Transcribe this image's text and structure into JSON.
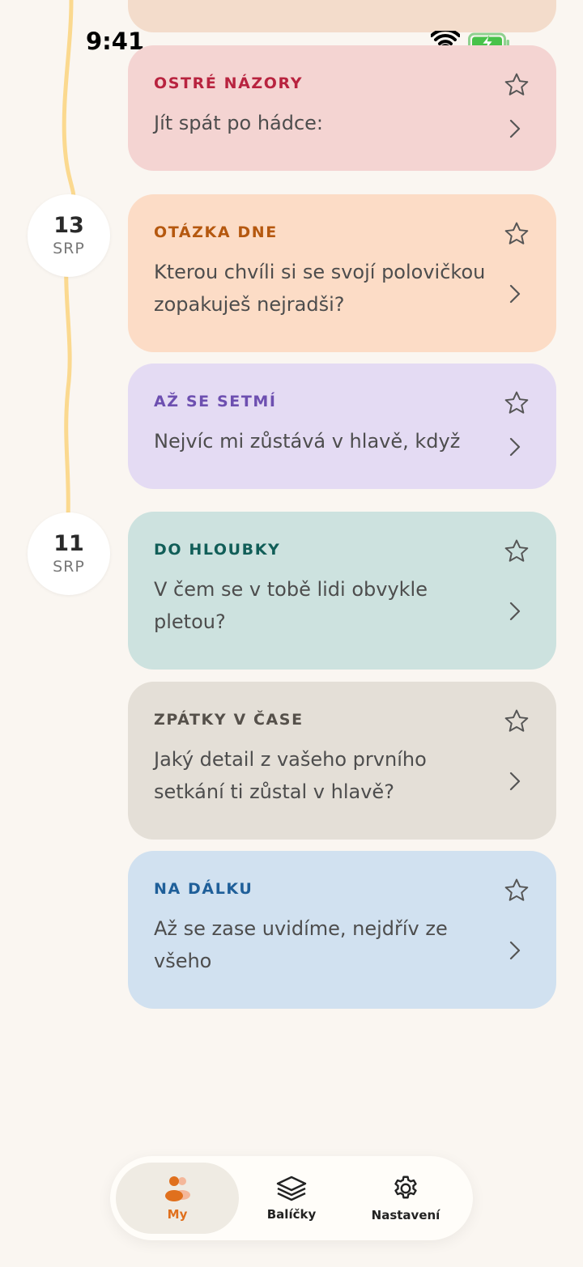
{
  "status_bar": {
    "time": "9:41"
  },
  "timeline": {
    "dates": [
      {
        "day": "13",
        "month": "SRP"
      },
      {
        "day": "11",
        "month": "SRP"
      }
    ]
  },
  "cards": [
    {
      "category": "OSTRÉ NÁZORY",
      "text": "Jít spát po hádce:",
      "bg": "#f4d4d2",
      "accent": "#b8233f"
    },
    {
      "category": "OTÁZKA DNE",
      "text": "Kterou chvíli si se svojí polovičkou zopakuješ nejradši?",
      "bg": "#fcdcc6",
      "accent": "#b5580f"
    },
    {
      "category": "AŽ SE SETMÍ",
      "text": "Nejvíc mi zůstává v hlavě, když",
      "bg": "#e4dbf3",
      "accent": "#6d4fb0"
    },
    {
      "category": "DO HLOUBKY",
      "text": "V čem se v tobě lidi obvykle pletou?",
      "bg": "#cde2df",
      "accent": "#115e58"
    },
    {
      "category": "ZPÁTKY V ČASE",
      "text": "Jaký detail z vašeho prvního setkání ti zůstal v hlavě?",
      "bg": "#e4dfd7",
      "accent": "#55504a"
    },
    {
      "category": "NA DÁLKU",
      "text": "Až se zase uvidíme, nejdřív ze všeho",
      "bg": "#d1e1f0",
      "accent": "#1f5f99"
    }
  ],
  "tabs": [
    {
      "label": "My",
      "icon": "people-icon",
      "active": true
    },
    {
      "label": "Balíčky",
      "icon": "layers-icon",
      "active": false
    },
    {
      "label": "Nastavení",
      "icon": "gear-icon",
      "active": false
    }
  ],
  "colors": {
    "background": "#faf6f1",
    "timeline_line": "#fbd98f",
    "tab_accent": "#e0701d"
  }
}
